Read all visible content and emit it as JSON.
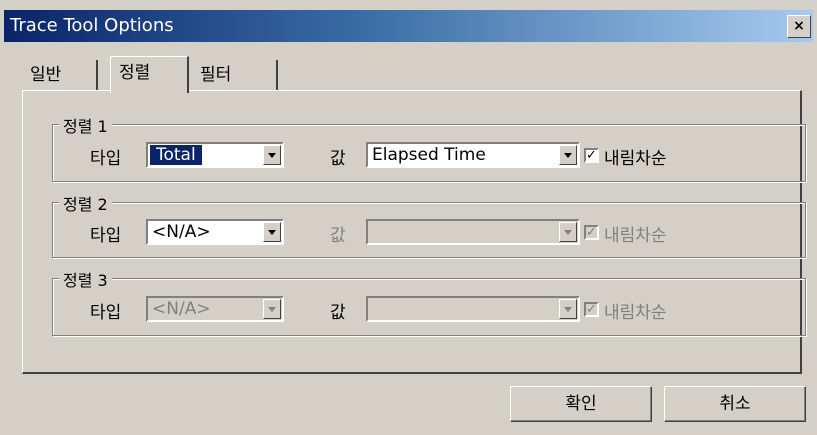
{
  "window": {
    "title": "Trace Tool Options",
    "close_symbol": "×"
  },
  "tabs": [
    {
      "label": "일반"
    },
    {
      "label": "정렬"
    },
    {
      "label": "필터"
    }
  ],
  "sort_groups": [
    {
      "legend": "정렬 1",
      "type_label": "타입",
      "type_value": "Total",
      "value_label": "값",
      "value_value": "Elapsed Time",
      "descending_label": "내림차순",
      "descending_checked": true,
      "type_enabled": true,
      "value_enabled": true
    },
    {
      "legend": "정렬 2",
      "type_label": "타입",
      "type_value": "<N/A>",
      "value_label": "값",
      "value_value": "",
      "descending_label": "내림차순",
      "descending_checked": true,
      "type_enabled": true,
      "value_enabled": false
    },
    {
      "legend": "정렬 3",
      "type_label": "타입",
      "type_value": "<N/A>",
      "value_label": "값",
      "value_value": "",
      "descending_label": "내림차순",
      "descending_checked": true,
      "type_enabled": false,
      "value_enabled": false
    }
  ],
  "buttons": {
    "ok": "확인",
    "cancel": "취소"
  },
  "check_mark": "✓"
}
